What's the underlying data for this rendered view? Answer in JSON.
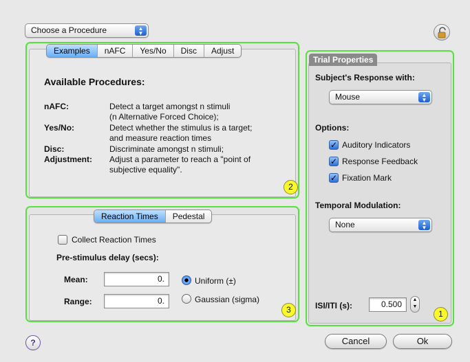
{
  "procedure_popup": {
    "label": "Choose a Procedure"
  },
  "procedures_panel": {
    "tabs": [
      "Examples",
      "nAFC",
      "Yes/No",
      "Disc",
      "Adjust"
    ],
    "selected_tab": "Examples",
    "heading": "Available Procedures:",
    "items": [
      {
        "name": "nAFC:",
        "description_lines": [
          "Detect a target amongst n stimuli",
          "(n Alternative Forced Choice);"
        ]
      },
      {
        "name": "Yes/No:",
        "description_lines": [
          "Detect whether the stimulus is a target;",
          "and measure reaction times"
        ]
      },
      {
        "name": "Disc:",
        "description_lines": [
          "Discriminate amongst n stimuli;"
        ]
      },
      {
        "name": "Adjustment:",
        "description_lines": [
          "Adjust a parameter to reach a \"point of",
          "subjective equality\"."
        ]
      }
    ],
    "badge": "2"
  },
  "reaction_panel": {
    "tabs": [
      "Reaction Times",
      "Pedestal"
    ],
    "selected_tab": "Reaction Times",
    "collect_label": "Collect Reaction Times",
    "collect_checked": false,
    "delay_heading": "Pre-stimulus delay (secs):",
    "mean_label": "Mean:",
    "mean_value": "0.",
    "range_label": "Range:",
    "range_value": "0.",
    "uniform_label": "Uniform (±)",
    "gaussian_label": "Gaussian (sigma)",
    "selected_distribution": "Uniform (±)",
    "badge": "3"
  },
  "trial_panel": {
    "title": "Trial Properties",
    "response_heading": "Subject's Response with:",
    "response_value": "Mouse",
    "options_heading": "Options:",
    "options": [
      {
        "label": "Auditory Indicators",
        "checked": true
      },
      {
        "label": "Response Feedback",
        "checked": true
      },
      {
        "label": "Fixation Mark",
        "checked": true
      }
    ],
    "modulation_heading": "Temporal Modulation:",
    "modulation_value": "None",
    "isi_label": "ISI/ITI (s):",
    "isi_value": "0.500",
    "badge": "1"
  },
  "footer": {
    "help_label": "?",
    "cancel_label": "Cancel",
    "ok_label": "Ok"
  }
}
